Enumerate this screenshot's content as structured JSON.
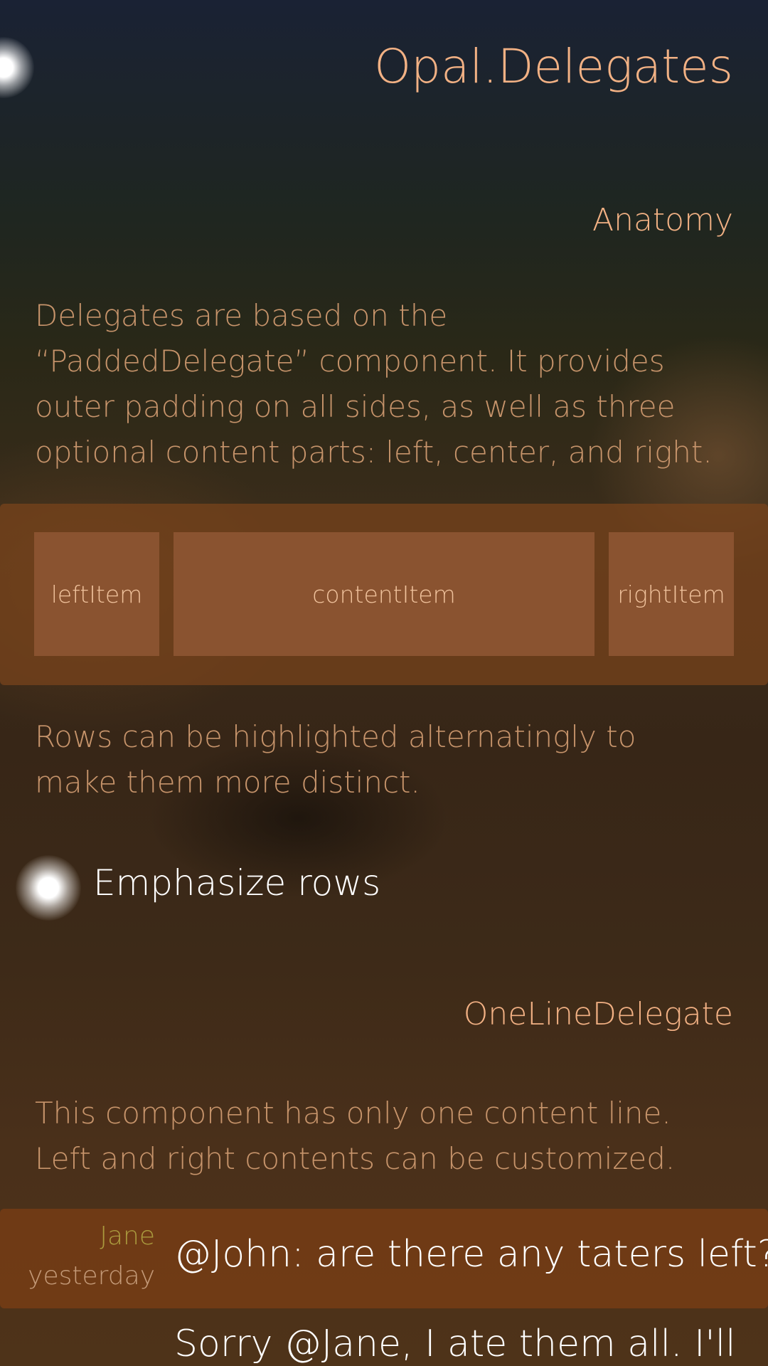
{
  "header": {
    "title": "Opal.Delegates"
  },
  "anatomy": {
    "heading": "Anatomy",
    "description": "Delegates are based on the “PaddedDelegate” component. It provides outer padding on all sides, as well as three optional content parts: left, center, and right.",
    "parts": {
      "left": "leftItem",
      "center": "contentItem",
      "right": "rightItem"
    },
    "rows_note": "Rows can be highlighted alternatingly to make them more distinct."
  },
  "emphasize_switch": {
    "label": "Emphasize rows",
    "checked": true
  },
  "one_line_delegate": {
    "heading": "OneLineDelegate",
    "description": "This component has only one content line. Left and right contents can be customized.",
    "messages": [
      {
        "name": "Jane",
        "time": "yesterday",
        "text": "@John: are there any taters left?",
        "emphasized": true
      },
      {
        "name": "",
        "time": "",
        "text": "Sorry @Jane, I ate them all. I'll",
        "emphasized": false
      }
    ]
  },
  "colors": {
    "accent": "#f2b184",
    "secondary_text": "#c7946b",
    "highlight_row": "#7a3e14",
    "name_text": "#aa9a3e"
  }
}
